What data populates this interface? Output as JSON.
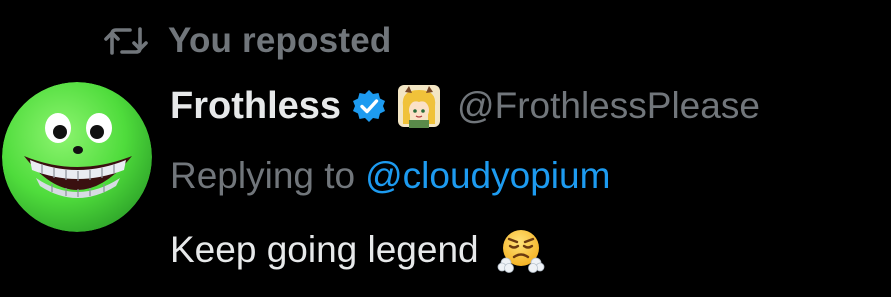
{
  "repost": {
    "icon": "repost-icon",
    "label": "You reposted"
  },
  "author": {
    "display_name": "Frothless",
    "handle": "@FrothlessPlease",
    "verified_icon": "verified-badge-icon",
    "name_emoji": "anime-character-emoji-icon",
    "avatar": "green-smiley-avatar"
  },
  "reply": {
    "prefix": "Replying to",
    "target": "@cloudyopium"
  },
  "tweet": {
    "text": "Keep going legend",
    "emoji": "face-with-steam-from-nose-emoji-icon"
  },
  "colors": {
    "background": "#000000",
    "primary_text": "#e7e9ea",
    "secondary_text": "#71767b",
    "link": "#1d9bf0",
    "verified": "#1d9bf0",
    "avatar_green": "#5ee84a"
  }
}
